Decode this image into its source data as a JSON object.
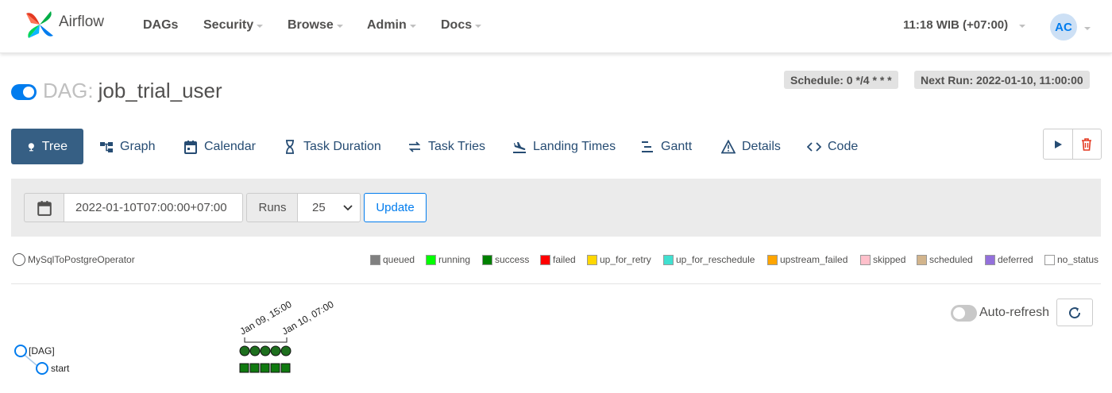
{
  "app": {
    "name": "Airflow"
  },
  "nav": {
    "items": [
      {
        "label": "DAGs",
        "has_caret": false
      },
      {
        "label": "Security",
        "has_caret": true
      },
      {
        "label": "Browse",
        "has_caret": true
      },
      {
        "label": "Admin",
        "has_caret": true
      },
      {
        "label": "Docs",
        "has_caret": true
      }
    ],
    "time": "11:18 WIB (+07:00)",
    "user_initials": "AC"
  },
  "dag": {
    "prefix": "DAG:",
    "id": "job_trial_user",
    "paused": false,
    "schedule": "Schedule: 0 */4 * * *",
    "next_run": "Next Run: 2022-01-10, 11:00:00"
  },
  "tabs": [
    {
      "label": "Tree",
      "icon": "tree-icon",
      "active": true
    },
    {
      "label": "Graph",
      "icon": "graph-icon",
      "active": false
    },
    {
      "label": "Calendar",
      "icon": "calendar-icon",
      "active": false
    },
    {
      "label": "Task Duration",
      "icon": "hourglass-icon",
      "active": false
    },
    {
      "label": "Task Tries",
      "icon": "retry-icon",
      "active": false
    },
    {
      "label": "Landing Times",
      "icon": "plane-landing-icon",
      "active": false
    },
    {
      "label": "Gantt",
      "icon": "gantt-icon",
      "active": false
    },
    {
      "label": "Details",
      "icon": "warning-icon",
      "active": false
    },
    {
      "label": "Code",
      "icon": "code-icon",
      "active": false
    }
  ],
  "filter": {
    "base_date": "2022-01-10T07:00:00+07:00",
    "runs_label": "Runs",
    "runs_value": "25",
    "update_label": "Update"
  },
  "operator_legend": {
    "label": "MySqlToPostgreOperator"
  },
  "state_legend": [
    {
      "label": "queued",
      "color": "#808080"
    },
    {
      "label": "running",
      "color": "#00ff00"
    },
    {
      "label": "success",
      "color": "#008000"
    },
    {
      "label": "failed",
      "color": "#ff0000"
    },
    {
      "label": "up_for_retry",
      "color": "#ffd700"
    },
    {
      "label": "up_for_reschedule",
      "color": "#40e0d0"
    },
    {
      "label": "upstream_failed",
      "color": "#ffa500"
    },
    {
      "label": "skipped",
      "color": "#ffc0cb"
    },
    {
      "label": "scheduled",
      "color": "#d2b48c"
    },
    {
      "label": "deferred",
      "color": "#9370db"
    },
    {
      "label": "no_status",
      "color": "#ffffff"
    }
  ],
  "auto_refresh": {
    "label": "Auto-refresh",
    "enabled": false
  },
  "tree": {
    "nodes": [
      {
        "label": "[DAG]"
      },
      {
        "label": "start"
      }
    ],
    "date_labels": [
      "Jan 09, 15:00",
      "Jan 10, 07:00"
    ],
    "run_states": [
      "success",
      "success",
      "success",
      "success",
      "success"
    ],
    "task_states": [
      "success",
      "success",
      "success",
      "success",
      "success"
    ],
    "colors": {
      "run_fill": "#1e6f1e",
      "task_fill": "#0f7a0f",
      "node_stroke": "#017cee"
    }
  }
}
